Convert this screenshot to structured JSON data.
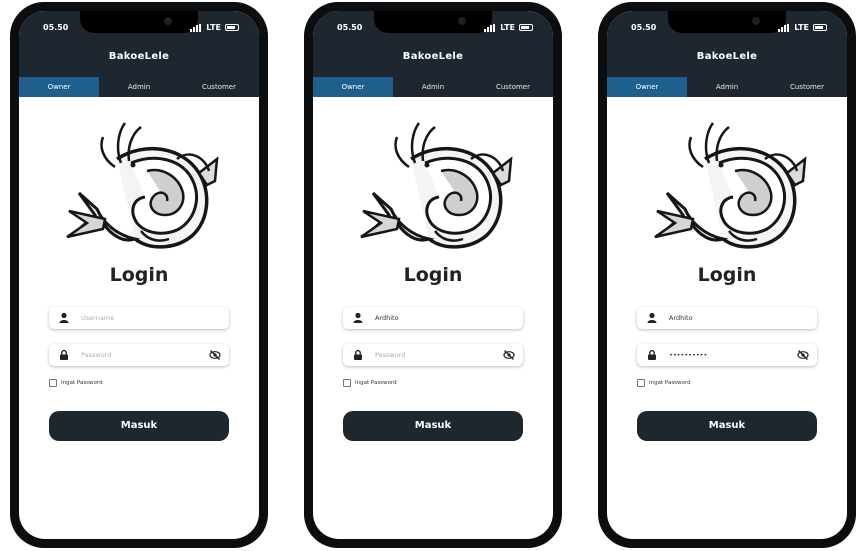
{
  "colors": {
    "appbar": "#1e272f",
    "tab_active": "#1e5f8e",
    "button": "#1e262e",
    "background": "#ffffff"
  },
  "screens": [
    {
      "status": {
        "time": "05.50",
        "network": "LTE"
      },
      "app_title": "BakoeLele",
      "tabs": [
        "Owner",
        "Admin",
        "Customer"
      ],
      "active_tab": "Owner",
      "heading": "Login",
      "username": {
        "value": "",
        "placeholder": "Username",
        "icon": "person-icon"
      },
      "password": {
        "value": "",
        "placeholder": "Password",
        "icon": "lock-icon",
        "toggle_icon": "eye-off-icon"
      },
      "remember_label": "Ingat Password",
      "remember_checked": false,
      "submit_label": "Masuk"
    },
    {
      "status": {
        "time": "05.50",
        "network": "LTE"
      },
      "app_title": "BakoeLele",
      "tabs": [
        "Owner",
        "Admin",
        "Customer"
      ],
      "active_tab": "Owner",
      "heading": "Login",
      "username": {
        "value": "Ardhito",
        "placeholder": "Username",
        "icon": "person-icon"
      },
      "password": {
        "value": "",
        "placeholder": "Password",
        "icon": "lock-icon",
        "toggle_icon": "eye-off-icon"
      },
      "remember_label": "Ingat Password",
      "remember_checked": false,
      "submit_label": "Masuk"
    },
    {
      "status": {
        "time": "05.50",
        "network": "LTE"
      },
      "app_title": "BakoeLele",
      "tabs": [
        "Owner",
        "Admin",
        "Customer"
      ],
      "active_tab": "Owner",
      "heading": "Login",
      "username": {
        "value": "Ardhito",
        "placeholder": "Username",
        "icon": "person-icon"
      },
      "password": {
        "value": "••••••••••",
        "placeholder": "Password",
        "icon": "lock-icon",
        "toggle_icon": "eye-off-icon"
      },
      "remember_label": "Ingat Password",
      "remember_checked": false,
      "submit_label": "Masuk"
    }
  ]
}
